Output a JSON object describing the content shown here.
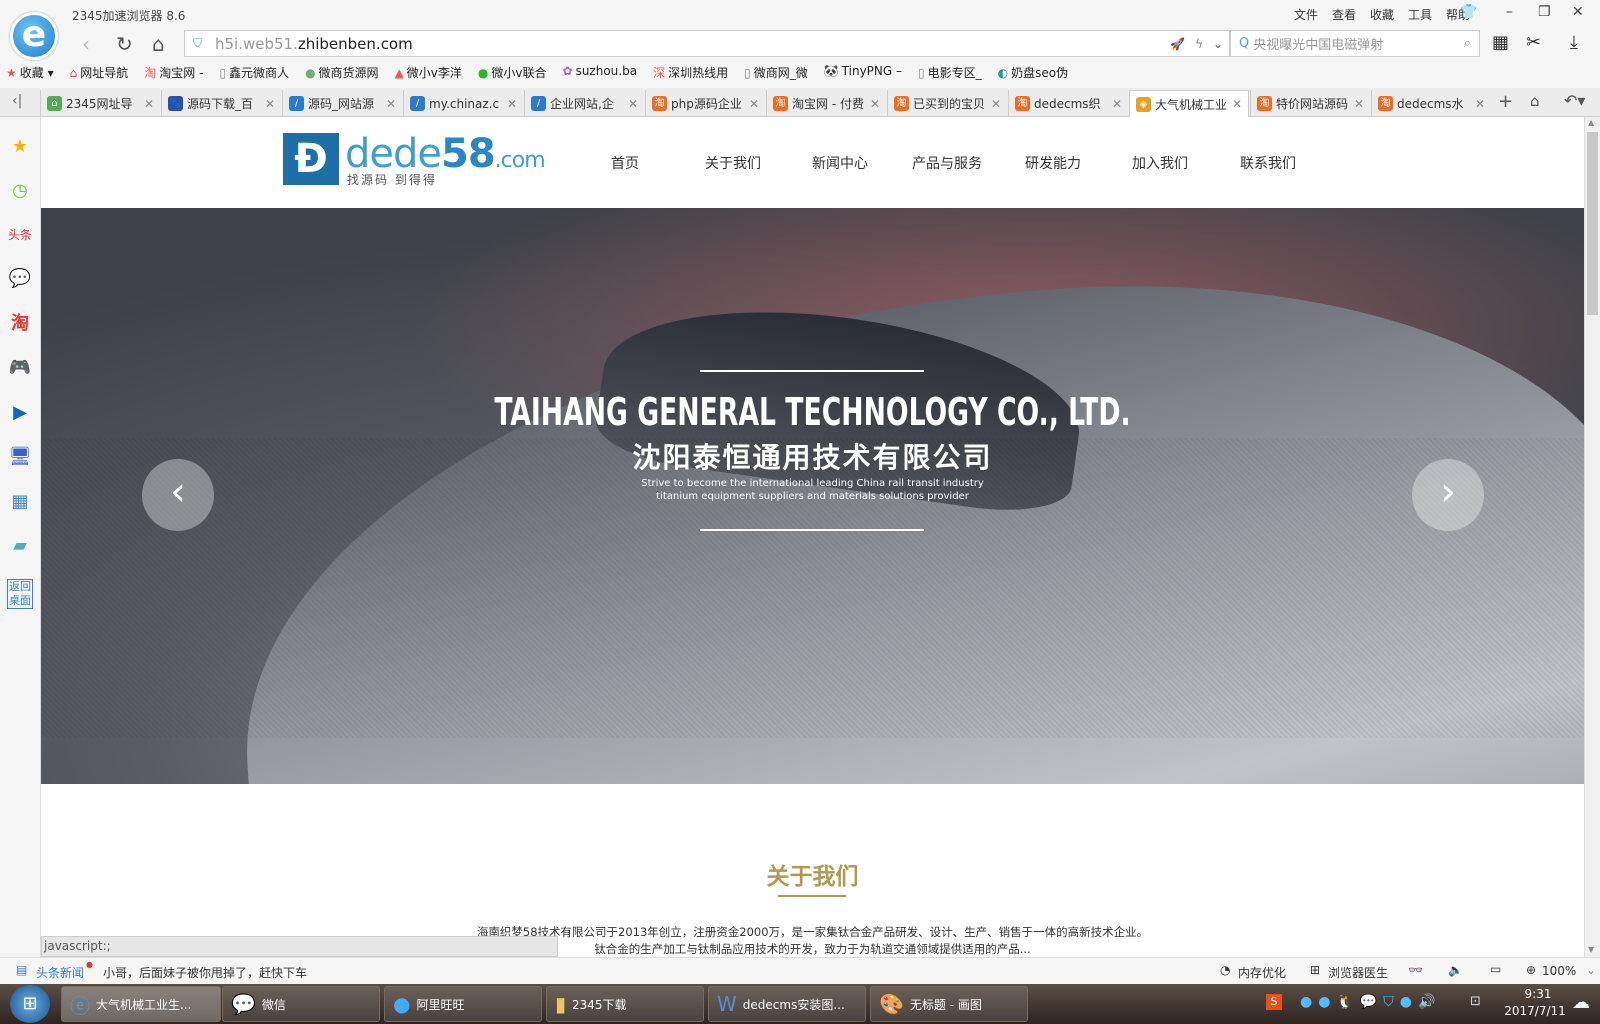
{
  "browser": {
    "title": "2345加速浏览器 8.6",
    "menu": [
      "文件",
      "查看",
      "收藏",
      "工具",
      "帮助"
    ],
    "url_prefix": "h5i.web51.",
    "url_domain": "zhibenben.com",
    "search_placeholder": "央视曝光中国电磁弹射"
  },
  "bookmarks": [
    "收藏",
    "网址导航",
    "淘宝网 -",
    "鑫元微商人",
    "微商货源网",
    "微小v李洋",
    "微小v联合",
    "suzhou.ba",
    "深圳热线用",
    "微商网_微",
    "TinyPNG –",
    "电影专区_",
    "奶盘seo伪"
  ],
  "tabs": [
    {
      "label": "2345网址导"
    },
    {
      "label": "源码下载_百"
    },
    {
      "label": "源码_网站源"
    },
    {
      "label": "my.chinaz.c"
    },
    {
      "label": "企业网站,企"
    },
    {
      "label": "php源码企业"
    },
    {
      "label": "淘宝网 - 付费"
    },
    {
      "label": "已买到的宝贝"
    },
    {
      "label": "dedecms织"
    },
    {
      "label": "大气机械工业",
      "active": true
    },
    {
      "label": "特价网站源码"
    },
    {
      "label": "dedecms水"
    }
  ],
  "sidebar": [
    "favorites-icon",
    "history-icon",
    "toutiao-icon",
    "wechat-icon",
    "taobao-icon",
    "game-icon",
    "video-icon",
    "computer-icon",
    "calculator-icon",
    "notepad-icon"
  ],
  "sidebar_back": "返回桌面",
  "site": {
    "logo_text": "dede",
    "logo_num": "58",
    "logo_suffix": ".com",
    "logo_slogan": "找源码 到得得",
    "nav": [
      "首页",
      "关于我们",
      "新闻中心",
      "产品与服务",
      "研发能力",
      "加入我们",
      "联系我们"
    ],
    "hero": {
      "title_en": "TAIHANG GENERAL TECHNOLOGY CO., LTD.",
      "title_cn": "沈阳泰恒通用技术有限公司",
      "sub1": "Strive to become the international leading China rail transit industry",
      "sub2": "titanium equipment suppliers and materials solutions provider",
      "prev": "‹",
      "next": "›"
    },
    "about": {
      "title": "关于我们",
      "line1": "海南织梦58技术有限公司于2013年创立，注册资金2000万，是一家集钛合金产品研发、设计、生产、销售于一体的高新技术企业。",
      "line2": "钛合金的生产加工与钛制品应用技术的开发，致力于为轨道交通领域提供适用的产品..."
    },
    "accent": "#b09a4e"
  },
  "status": {
    "link": "javascript:;",
    "news_label": "头条新闻",
    "news_text": "小哥，后面妹子被你甩掉了，赶快下车",
    "memory": "内存优化",
    "doctor": "浏览器医生",
    "zoom": "100%"
  },
  "taskbar": {
    "items": [
      "大气机械工业生...",
      "微信",
      "阿里旺旺",
      "2345下载",
      "dedecms安装图...",
      "无标题 - 画图"
    ],
    "time": "9:31",
    "date": "2017/7/11"
  }
}
